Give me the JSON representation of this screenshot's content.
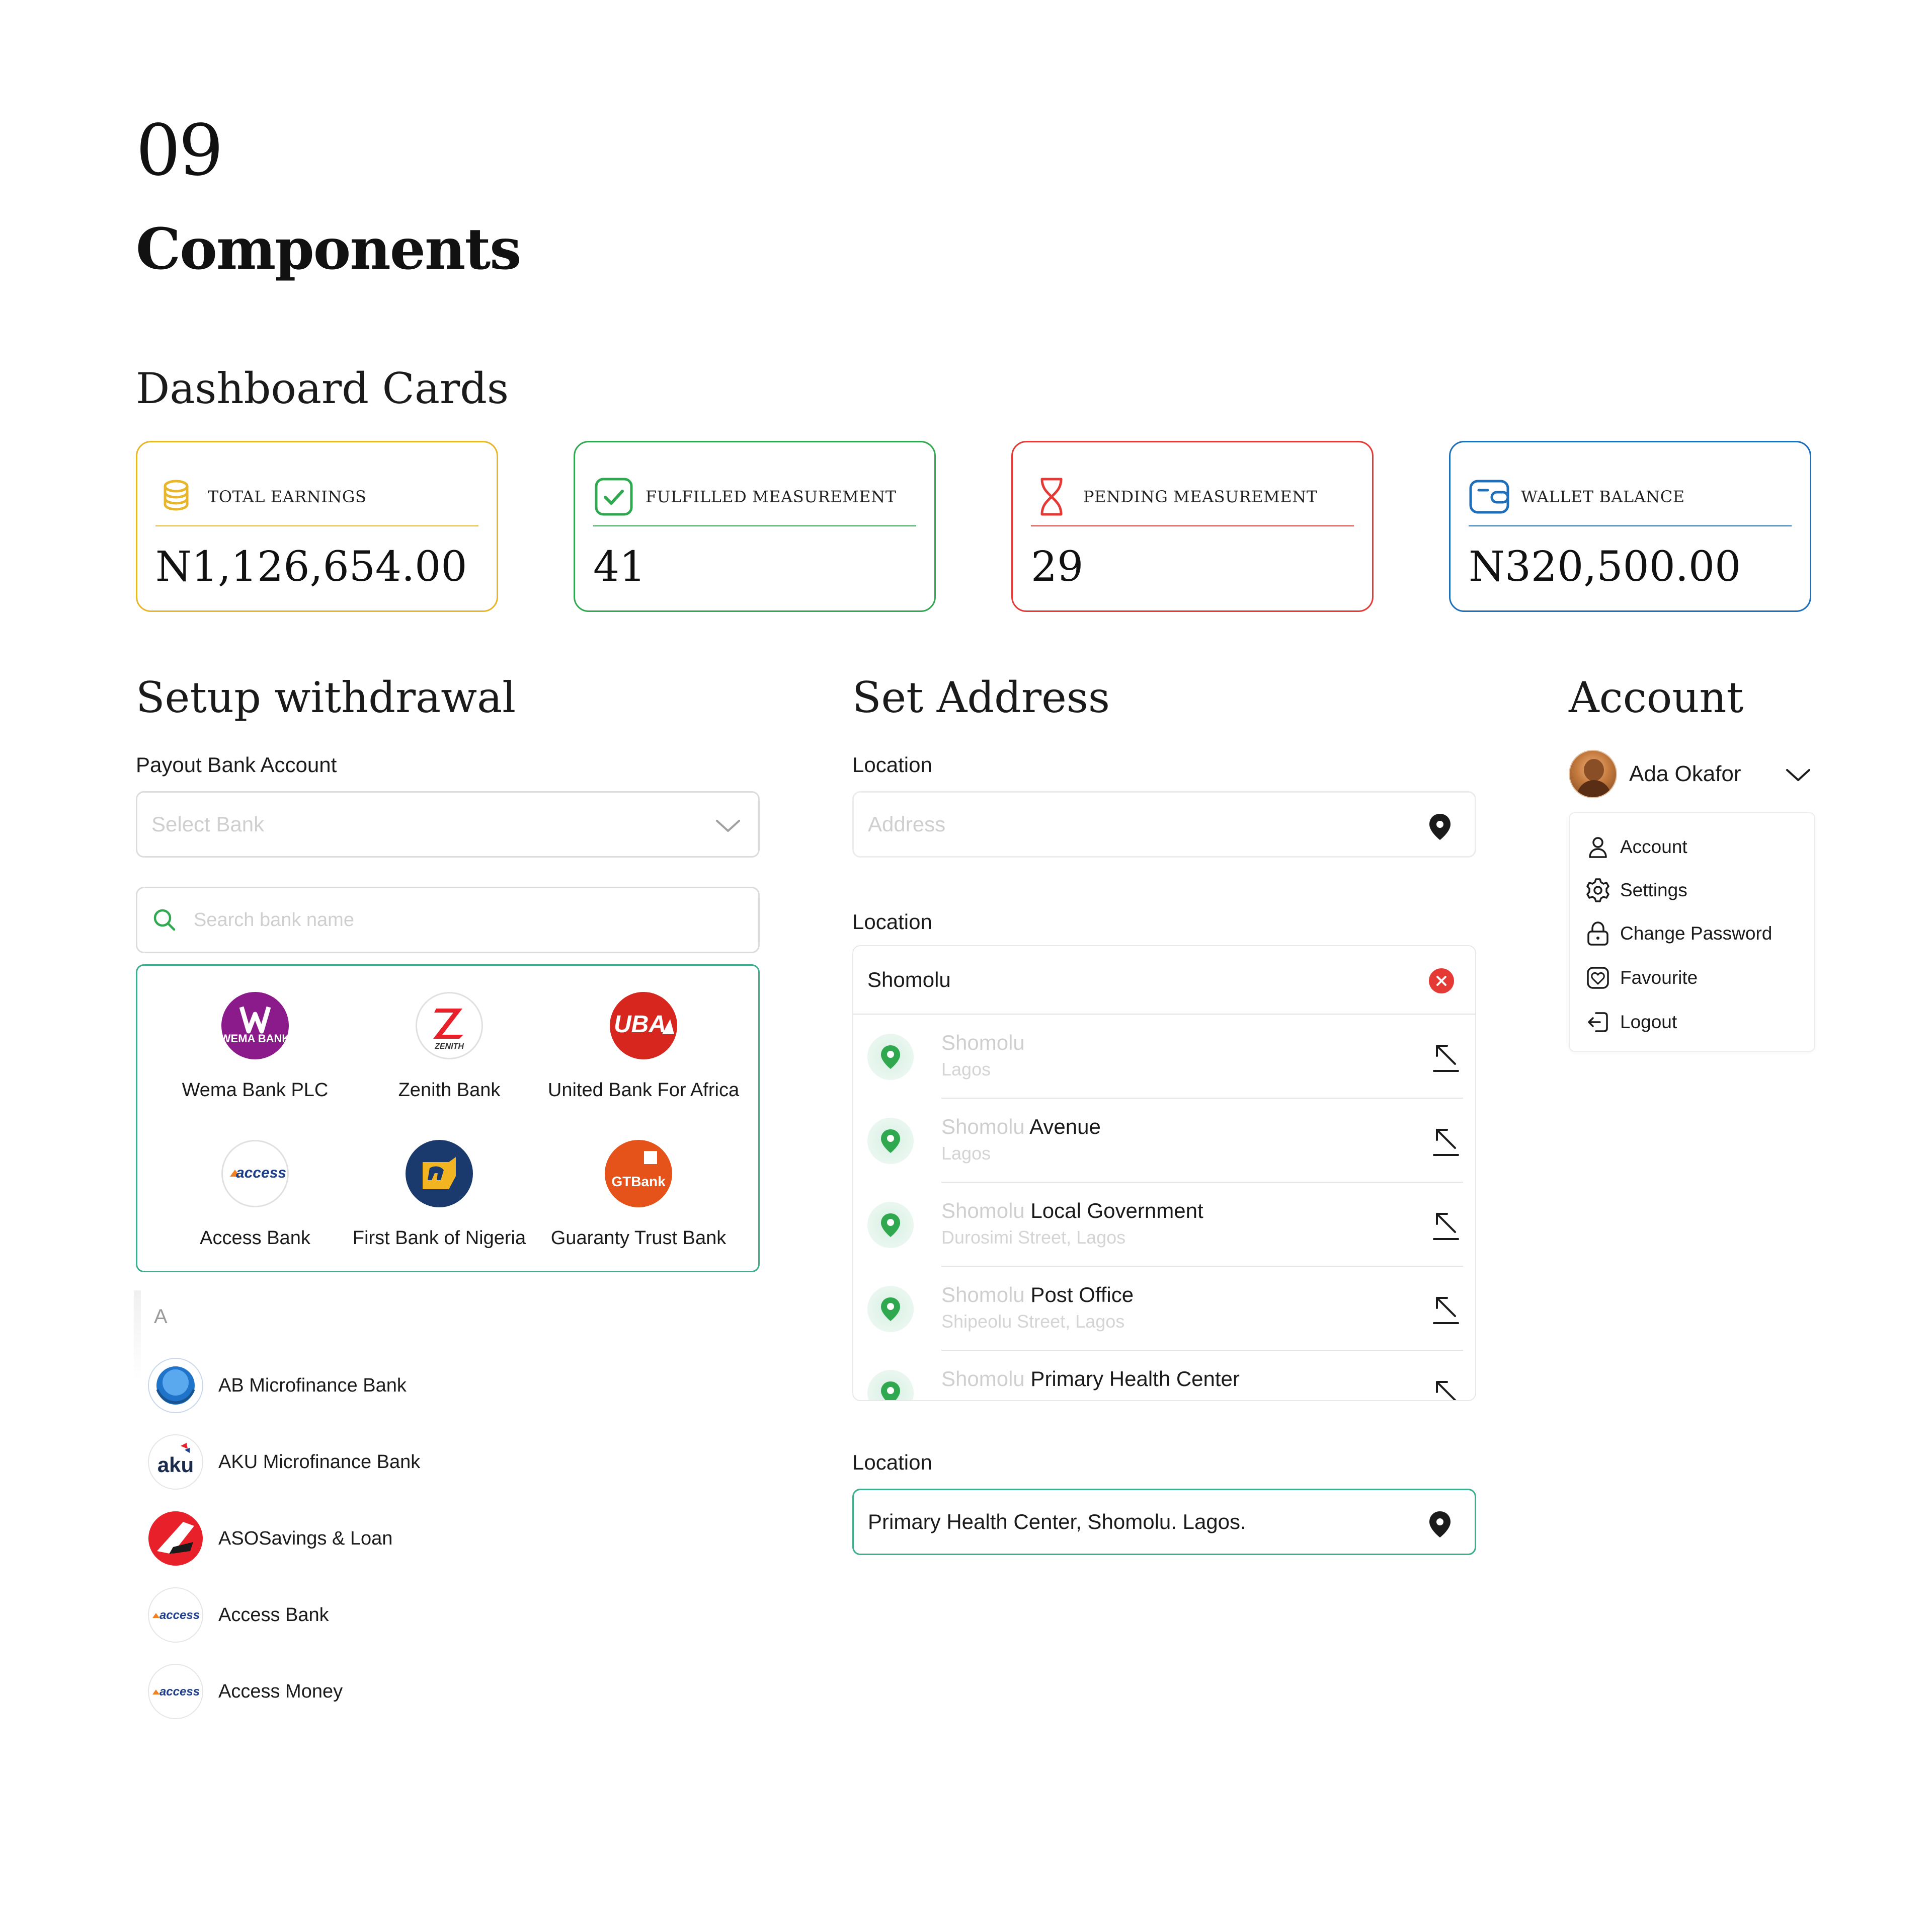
{
  "page": {
    "number": "09",
    "title": "Components"
  },
  "dashboard": {
    "title": "Dashboard Cards",
    "cards": [
      {
        "label": "TOTAL EARNINGS",
        "value": "N1,126,654.00",
        "color": "#e8b62a",
        "icon": "coins-icon"
      },
      {
        "label": "FULFILLED MEASUREMENT",
        "value": "41",
        "color": "#2fa84f",
        "icon": "checkbox-icon"
      },
      {
        "label": "PENDING MEASUREMENT",
        "value": "29",
        "color": "#e53935",
        "icon": "hourglass-icon"
      },
      {
        "label": "WALLET BALANCE",
        "value": "N320,500.00",
        "color": "#1e6fb8",
        "icon": "wallet-icon"
      }
    ]
  },
  "withdrawal": {
    "title": "Setup withdrawal",
    "payout_label": "Payout Bank Account",
    "select_placeholder": "Select Bank",
    "search_placeholder": "Search bank name",
    "grid": [
      {
        "name": "Wema Bank PLC",
        "logo_text": "WEMA BANK",
        "color": "#8b1a8b"
      },
      {
        "name": "Zenith Bank",
        "logo_text": "ZENITH",
        "color": "#e8202a"
      },
      {
        "name": "United Bank For Africa",
        "logo_text": "UBA",
        "color": "#d7261e"
      },
      {
        "name": "Access Bank",
        "logo_text": "access",
        "color": "#1d3e8a"
      },
      {
        "name": "First Bank of Nigeria",
        "logo_text": "",
        "color": "#1a3a6e"
      },
      {
        "name": "Guaranty Trust Bank",
        "logo_text": "GTBank",
        "color": "#e5531a"
      }
    ],
    "index_letter": "A",
    "list": [
      {
        "name": "AB Microfinance Bank",
        "logo_text": ""
      },
      {
        "name": "AKU Microfinance Bank",
        "logo_text": "aku"
      },
      {
        "name": "ASOSavings & Loan",
        "logo_text": ""
      },
      {
        "name": "Access Bank",
        "logo_text": "access"
      },
      {
        "name": "Access Money",
        "logo_text": "access"
      }
    ]
  },
  "address": {
    "title": "Set Address",
    "location_label": "Location",
    "address_placeholder": "Address",
    "search_value": "Shomolu",
    "suggestions": [
      {
        "match": "Shomolu",
        "rest": "",
        "sub": "Lagos"
      },
      {
        "match": "Shomolu",
        "rest": " Avenue",
        "sub": "Lagos"
      },
      {
        "match": "Shomolu",
        "rest": " Local Government",
        "sub": "Durosimi Street, Lagos"
      },
      {
        "match": "Shomolu",
        "rest": " Post Office",
        "sub": "Shipeolu Street, Lagos"
      },
      {
        "match": "Shomolu",
        "rest": " Primary Health Center",
        "sub": ""
      }
    ],
    "selected_value": "Primary Health Center, Shomolu. Lagos."
  },
  "account": {
    "title": "Account",
    "user_name": "Ada Okafor",
    "menu": [
      {
        "label": "Account",
        "icon": "user-icon"
      },
      {
        "label": "Settings",
        "icon": "gear-icon"
      },
      {
        "label": "Change Password",
        "icon": "lock-icon"
      },
      {
        "label": "Favourite",
        "icon": "heart-icon"
      },
      {
        "label": "Logout",
        "icon": "logout-icon"
      }
    ]
  }
}
